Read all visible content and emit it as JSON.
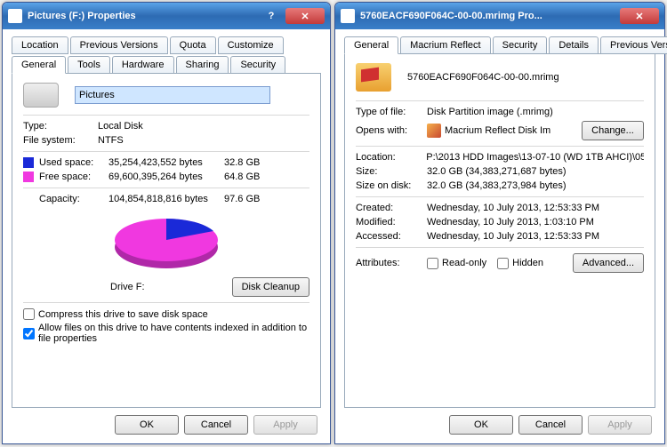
{
  "left": {
    "title": "Pictures (F:) Properties",
    "tabs_upper": [
      "Location",
      "Previous Versions",
      "Quota",
      "Customize"
    ],
    "tabs_lower": [
      "General",
      "Tools",
      "Hardware",
      "Sharing",
      "Security"
    ],
    "active_tab": "General",
    "drive_name": "Pictures",
    "type_label": "Type:",
    "type_value": "Local Disk",
    "fs_label": "File system:",
    "fs_value": "NTFS",
    "used_label": "Used space:",
    "used_bytes": "35,254,423,552 bytes",
    "used_gb": "32.8 GB",
    "free_label": "Free space:",
    "free_bytes": "69,600,395,264 bytes",
    "free_gb": "64.8 GB",
    "cap_label": "Capacity:",
    "cap_bytes": "104,854,818,816 bytes",
    "cap_gb": "97.6 GB",
    "drive_letter": "Drive F:",
    "disk_cleanup": "Disk Cleanup",
    "compress": "Compress this drive to save disk space",
    "allow_index": "Allow files on this drive to have contents indexed in addition to file properties",
    "ok": "OK",
    "cancel": "Cancel",
    "apply": "Apply"
  },
  "right": {
    "title": "5760EACF690F064C-00-00.mrimg Pro...",
    "tabs": [
      "General",
      "Macrium Reflect",
      "Security",
      "Details",
      "Previous Versions"
    ],
    "active_tab": "General",
    "filename": "5760EACF690F064C-00-00.mrimg",
    "type_label": "Type of file:",
    "type_value": "Disk Partition image (.mrimg)",
    "opens_label": "Opens with:",
    "opens_value": "Macrium Reflect Disk Im",
    "change": "Change...",
    "loc_label": "Location:",
    "loc_value": "P:\\2013 HDD Images\\13-07-10 (WD 1TB AHCI)\\05",
    "size_label": "Size:",
    "size_value": "32.0 GB (34,383,271,687 bytes)",
    "ondisk_label": "Size on disk:",
    "ondisk_value": "32.0 GB (34,383,273,984 bytes)",
    "created_label": "Created:",
    "created_value": "Wednesday, 10 July 2013, 12:53:33 PM",
    "modified_label": "Modified:",
    "modified_value": "Wednesday, 10 July 2013, 1:03:10 PM",
    "accessed_label": "Accessed:",
    "accessed_value": "Wednesday, 10 July 2013, 12:53:33 PM",
    "attr_label": "Attributes:",
    "readonly": "Read-only",
    "hidden": "Hidden",
    "advanced": "Advanced...",
    "ok": "OK",
    "cancel": "Cancel",
    "apply": "Apply"
  },
  "chart_data": {
    "type": "pie",
    "title": "Drive F:",
    "series": [
      {
        "name": "Used space",
        "value_bytes": 35254423552,
        "value_gb": 32.8,
        "color": "#1a29d8"
      },
      {
        "name": "Free space",
        "value_bytes": 69600395264,
        "value_gb": 64.8,
        "color": "#f038e0"
      }
    ],
    "total_bytes": 104854818816,
    "total_gb": 97.6
  }
}
